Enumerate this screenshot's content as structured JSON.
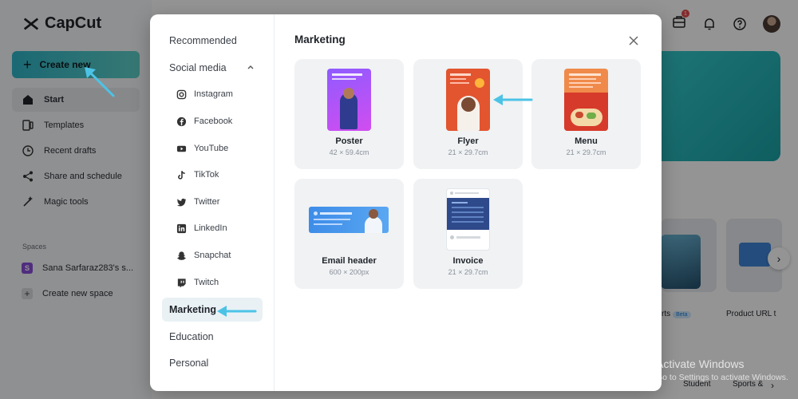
{
  "app": {
    "logo_text": "CapCut",
    "create_new_label": "Create new",
    "nav": [
      {
        "label": "Start",
        "icon": "home-icon"
      },
      {
        "label": "Templates",
        "icon": "templates-icon"
      },
      {
        "label": "Recent drafts",
        "icon": "clock-icon"
      },
      {
        "label": "Share and schedule",
        "icon": "share-icon"
      },
      {
        "label": "Magic tools",
        "icon": "magic-wand-icon"
      }
    ],
    "spaces_label": "Spaces",
    "space_name": "Sana Sarfaraz283's s...",
    "space_initial": "S",
    "create_space_label": "Create new space",
    "notification_count": "1",
    "bg_card_label_1": "rts",
    "bg_card_beta": "Beta",
    "bg_card_label_2": "Product URL t",
    "bg_chip_1": "Student",
    "bg_chip_2": "Sports &"
  },
  "modal": {
    "title": "Marketing",
    "categories": {
      "recommended": "Recommended",
      "social_media": "Social media",
      "marketing": "Marketing",
      "education": "Education",
      "personal": "Personal"
    },
    "social_items": [
      {
        "label": "Instagram",
        "icon": "instagram-icon"
      },
      {
        "label": "Facebook",
        "icon": "facebook-icon"
      },
      {
        "label": "YouTube",
        "icon": "youtube-icon"
      },
      {
        "label": "TikTok",
        "icon": "tiktok-icon"
      },
      {
        "label": "Twitter",
        "icon": "twitter-icon"
      },
      {
        "label": "LinkedIn",
        "icon": "linkedin-icon"
      },
      {
        "label": "Snapchat",
        "icon": "snapchat-icon"
      },
      {
        "label": "Twitch",
        "icon": "twitch-icon"
      }
    ],
    "templates": [
      {
        "name": "Poster",
        "size": "42 × 59.4cm"
      },
      {
        "name": "Flyer",
        "size": "21 × 29.7cm"
      },
      {
        "name": "Menu",
        "size": "21 × 29.7cm"
      },
      {
        "name": "Email header",
        "size": "600 × 200px"
      },
      {
        "name": "Invoice",
        "size": "21 × 29.7cm"
      }
    ]
  },
  "watermark": {
    "line1": "Activate Windows",
    "line2": "Go to Settings to activate Windows."
  },
  "colors": {
    "accent_teal": "#2fb5c8",
    "annotation_arrow": "#4cc3e6",
    "active_category_bg": "#e9f1f5"
  }
}
